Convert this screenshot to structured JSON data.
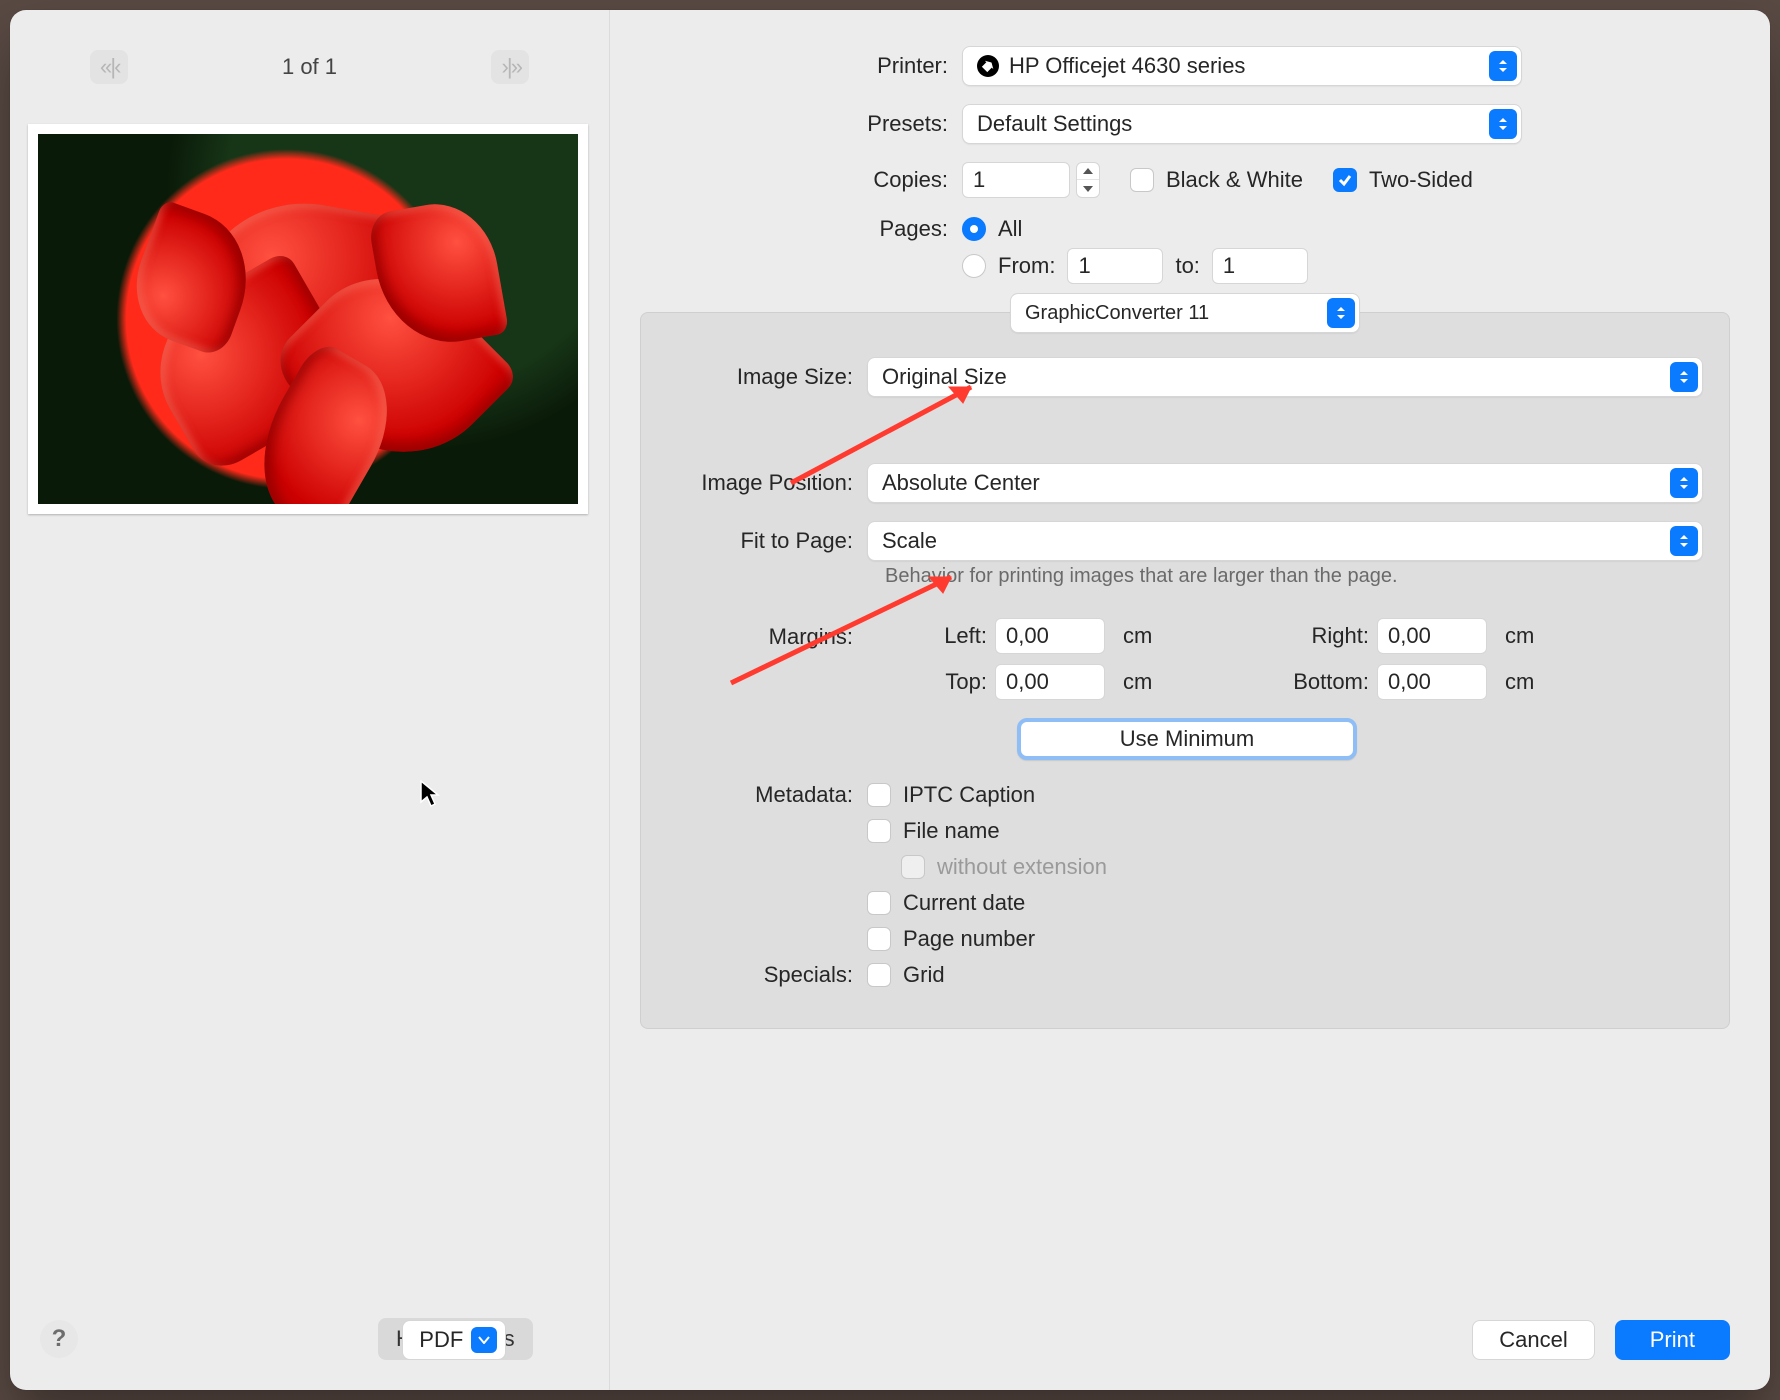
{
  "preview": {
    "page_indicator": "1 of 1",
    "nav_prev_glyph": "«  | ‹",
    "nav_next_glyph": "›  | »"
  },
  "main": {
    "printer_label": "Printer:",
    "printer_value": "HP Officejet 4630 series",
    "presets_label": "Presets:",
    "presets_value": "Default Settings",
    "copies_label": "Copies:",
    "copies_value": "1",
    "bw_label": "Black & White",
    "bw_checked": false,
    "twosided_label": "Two-Sided",
    "twosided_checked": true,
    "pages_label": "Pages:",
    "pages_all_label": "All",
    "pages_from_label": "From:",
    "pages_to_label": "to:",
    "pages_from_value": "1",
    "pages_to_value": "1"
  },
  "app": {
    "selector_value": "GraphicConverter 11",
    "image_size_label": "Image Size:",
    "image_size_value": "Original Size",
    "image_position_label": "Image Position:",
    "image_position_value": "Absolute Center",
    "fit_label": "Fit to Page:",
    "fit_value": "Scale",
    "fit_hint": "Behavior for printing images that are larger than the page.",
    "margins_label": "Margins:",
    "margin_labels": {
      "left": "Left:",
      "right": "Right:",
      "top": "Top:",
      "bottom": "Bottom:"
    },
    "margin_values": {
      "left": "0,00",
      "right": "0,00",
      "top": "0,00",
      "bottom": "0,00"
    },
    "margin_unit": "cm",
    "use_minimum": "Use Minimum",
    "metadata_label": "Metadata:",
    "metadata_items": {
      "iptc": "IPTC Caption",
      "filename": "File name",
      "without_ext": "without extension",
      "current_date": "Current date",
      "page_number": "Page number"
    },
    "specials_label": "Specials:",
    "specials_grid": "Grid"
  },
  "footer": {
    "help_glyph": "?",
    "hide_details": "Hide Details",
    "pdf_label": "PDF",
    "cancel": "Cancel",
    "print": "Print"
  }
}
